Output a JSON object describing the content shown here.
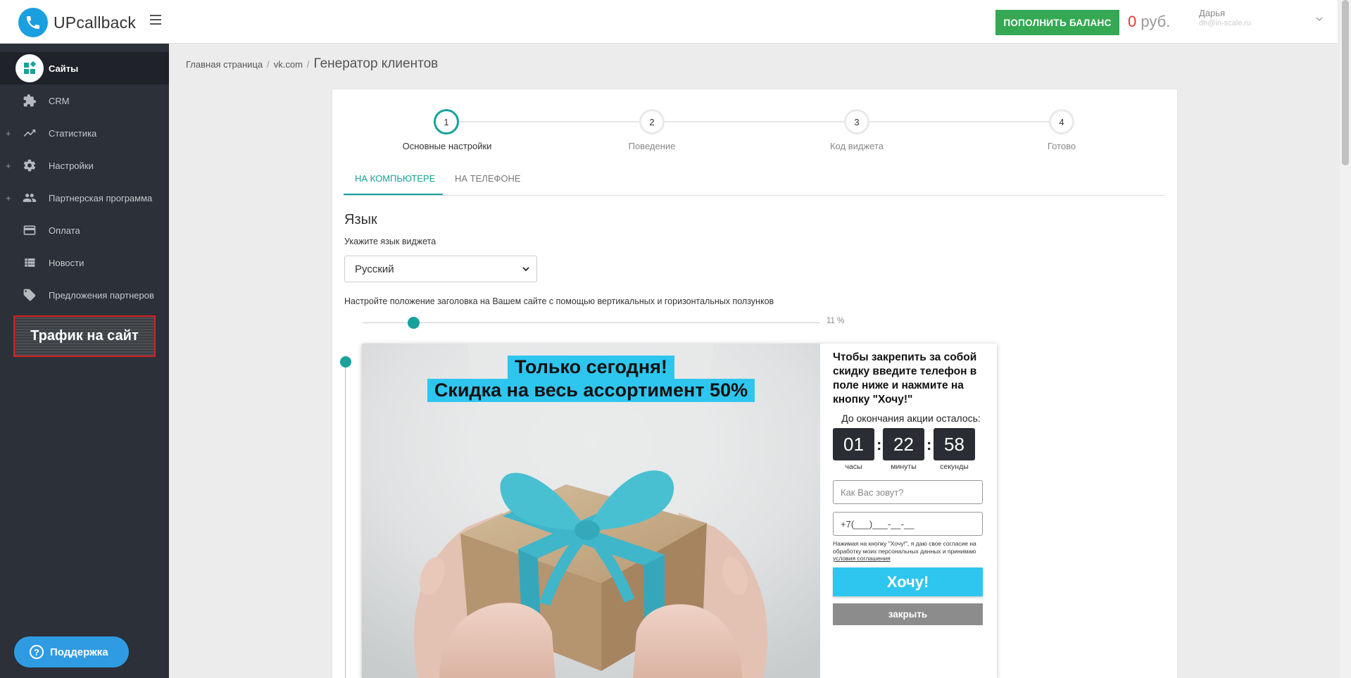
{
  "header": {
    "logo_text": "UPcallback",
    "balance_button": "ПОПОЛНИТЬ БАЛАНС",
    "balance_amount": "0",
    "balance_currency": "руб.",
    "user_name": "Дарья",
    "user_email": "dh@in-scale.ru"
  },
  "sidebar": {
    "items": [
      {
        "label": "Сайты",
        "icon": "apps-icon"
      },
      {
        "label": "CRM",
        "icon": "puzzle-icon"
      },
      {
        "label": "Статистика",
        "icon": "trending-up-icon"
      },
      {
        "label": "Настройки",
        "icon": "gear-icon"
      },
      {
        "label": "Партнерская программа",
        "icon": "people-icon"
      },
      {
        "label": "Оплата",
        "icon": "credit-card-icon"
      },
      {
        "label": "Новости",
        "icon": "list-icon"
      },
      {
        "label": "Предложения партнеров",
        "icon": "tag-icon"
      }
    ],
    "traffic_banner": "Трафик на сайт",
    "support_button": "Поддержка",
    "expand_symbol": "+"
  },
  "breadcrumb": {
    "home": "Главная страница",
    "site": "vk.com",
    "separator": "/",
    "current": "Генератор клиентов"
  },
  "stepper": {
    "steps": [
      {
        "number": "1",
        "label": "Основные настройки"
      },
      {
        "number": "2",
        "label": "Поведение"
      },
      {
        "number": "3",
        "label": "Код виджета"
      },
      {
        "number": "4",
        "label": "Готово"
      }
    ],
    "active_step": 1
  },
  "tabs": {
    "desktop": "НА КОМПЬЮТЕРЕ",
    "mobile": "НА ТЕЛЕФОНЕ"
  },
  "language": {
    "heading": "Язык",
    "label": "Укажите язык виджета",
    "selected": "Русский"
  },
  "position": {
    "label": "Настройте положение заголовка на Вашем сайте с помощью вертикальных и горизонтальных ползунков",
    "horizontal_value": "11 %",
    "horizontal_fraction": 0.11,
    "vertical_fraction": 0.02
  },
  "widget": {
    "headline_line1": "Только сегодня!",
    "headline_line2": "Скидка на весь ассортимент 50%",
    "form_title": "Чтобы закрепить за собой скидку введите телефон в поле ниже и нажмите на кнопку \"Хочу!\"",
    "timer_title": "До окончания акции осталось:",
    "timer": {
      "hours": "01",
      "minutes": "22",
      "seconds": "58",
      "hours_label": "часы",
      "minutes_label": "минуты",
      "seconds_label": "секунды",
      "separator": ":"
    },
    "name_placeholder": "Как Вас зовут?",
    "phone_mask": "+7(___)___-__-__",
    "consent_text": "Нажимая на кнопку \"Хочу!\", я даю свое согласие на обработку моих персональных данных и принимаю",
    "consent_link": "условия соглашения",
    "submit_button": "Хочу!",
    "close_button": "закрыть"
  },
  "colors": {
    "accent": "#17a29a",
    "balance_green": "#34a853",
    "widget_cyan": "#2ec6ef",
    "sidebar_bg": "#2c3038"
  }
}
